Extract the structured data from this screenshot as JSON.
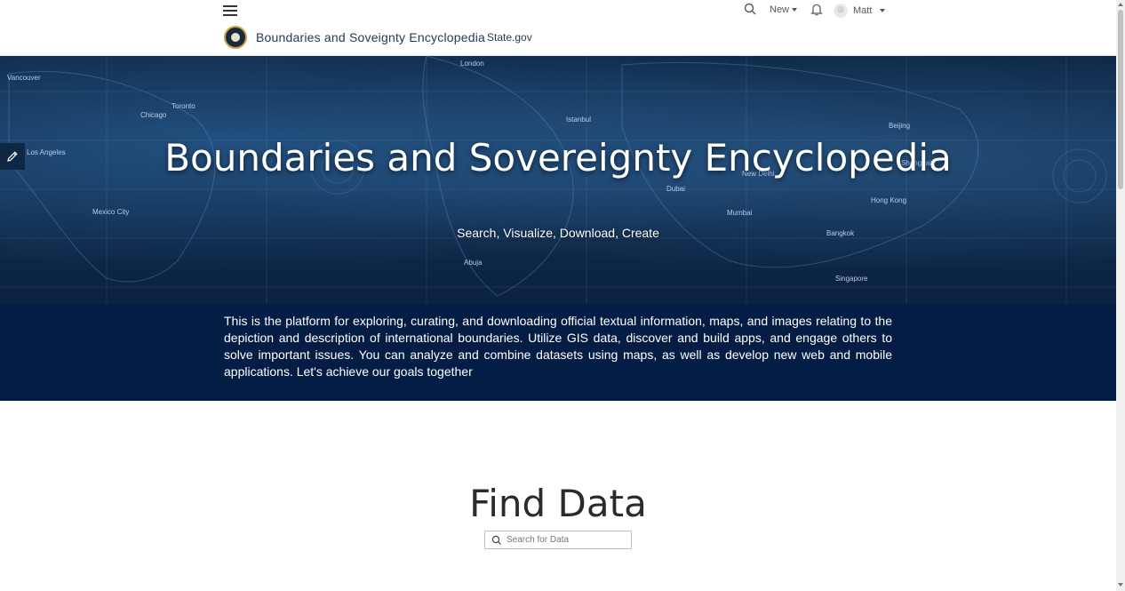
{
  "header": {
    "menu_icon": "hamburger-menu-icon",
    "search_icon": "search-icon",
    "new_label": "New",
    "notifications_icon": "bell-icon",
    "user_name": "Matt",
    "site_title": "Boundaries and Soveignty Encyclopedia",
    "site_link": "State.gov",
    "seal_icon": "state-department-seal"
  },
  "hero": {
    "title": "Boundaries and Sovereignty Encyclopedia",
    "subtitle": "Search, Visualize, Download, Create",
    "edit_icon": "pencil-icon",
    "cities": [
      "Vancouver",
      "Chicago",
      "Toronto",
      "Los Angeles",
      "Mexico City",
      "London",
      "Istanbul",
      "Dubai",
      "New Delhi",
      "Mumbai",
      "Beijing",
      "Shanghai",
      "Hong Kong",
      "Bangkok",
      "Singapore",
      "Abuja"
    ]
  },
  "intro": {
    "text": "This is the platform for exploring, curating, and downloading official textual information, maps, and images relating to the depiction and description of international boundaries. Utilize GIS data, discover and build apps, and engage others to solve important issues. You can analyze and combine datasets using maps, as well as develop new web and mobile applications. Let's achieve our goals together"
  },
  "find": {
    "title": "Find Data",
    "search_placeholder": "Search for Data"
  },
  "colors": {
    "intro_band": "#041d44",
    "hero_dark": "#0d2643",
    "header_text": "#1f3a55"
  }
}
